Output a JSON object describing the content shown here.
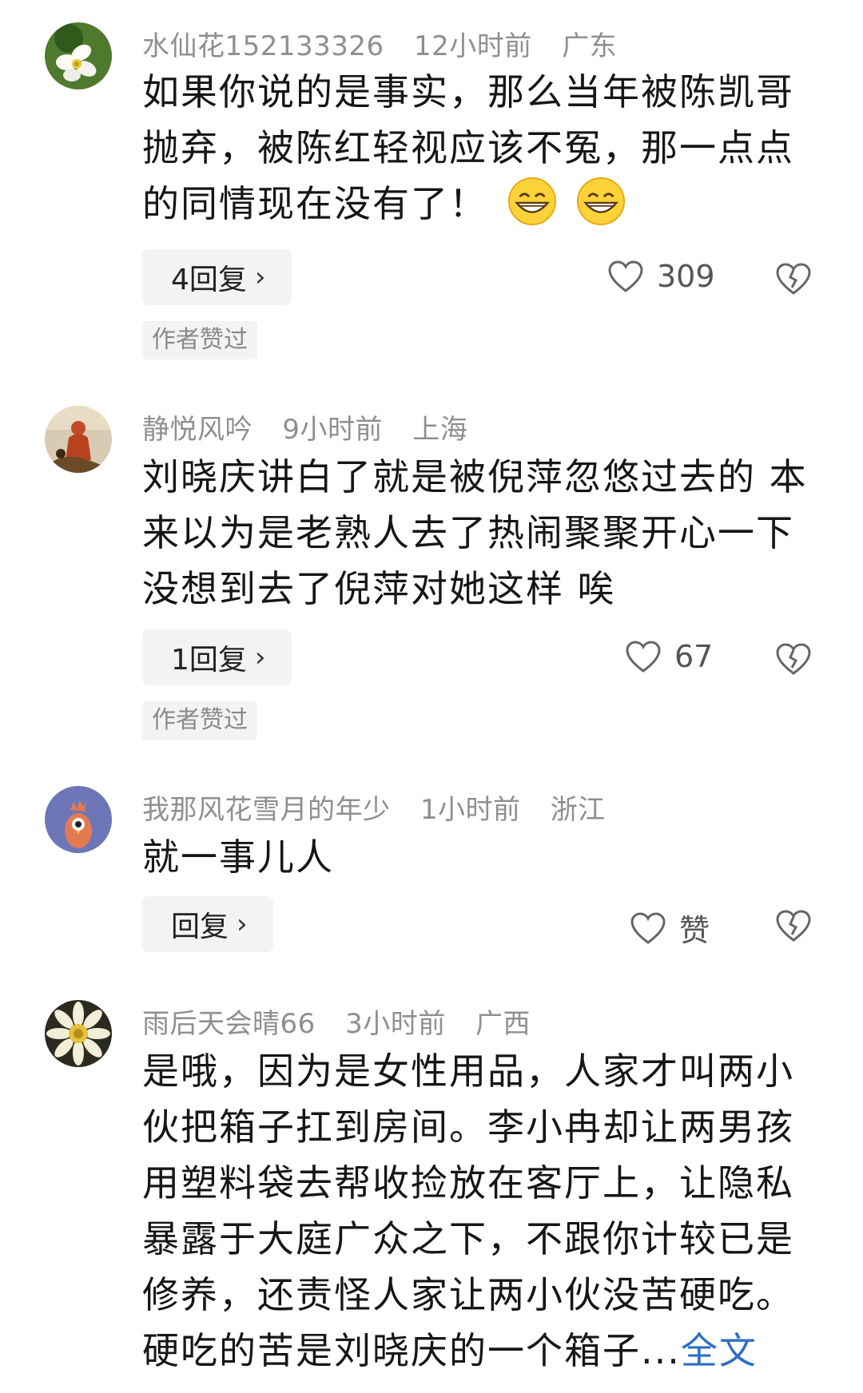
{
  "comments": [
    {
      "username": "水仙花152133326",
      "time": "12小时前",
      "location": "广东",
      "text": "如果你说的是事实，那么当年被陈凯哥抛弃，被陈红轻视应该不冤，那一点点的同情现在没有了！",
      "emoji": "grinning-face-emoji ×2",
      "reply_label": "4回复",
      "like_count": "309",
      "badge": "作者赞过"
    },
    {
      "username": "静悦风吟",
      "time": "9小时前",
      "location": "上海",
      "text": "刘晓庆讲白了就是被倪萍忽悠过去的 本来以为是老熟人去了热闹聚聚开心一下 没想到去了倪萍对她这样 唉",
      "reply_label": "1回复",
      "like_count": "67",
      "badge": "作者赞过"
    },
    {
      "username": "我那风花雪月的年少",
      "time": "1小时前",
      "location": "浙江",
      "text": "就一事儿人",
      "reply_label": "回复",
      "like_count": "赞"
    },
    {
      "username": "雨后天会晴66",
      "time": "3小时前",
      "location": "广西",
      "text": "是哦，因为是女性用品，人家才叫两小伙把箱子扛到房间。李小冉却让两男孩用塑料袋去帮收捡放在客厅上，让隐私暴露于大庭广众之下，不跟你计较已是修养，还责怪人家让两小伙没苦硬吃。硬吃的苦是刘晓庆的一个箱子...",
      "more_label": "全文"
    }
  ],
  "icons": {
    "reply_chevron": "chevron-right-icon",
    "like": "heart-outline-icon",
    "dislike": "broken-heart-icon"
  },
  "colors": {
    "meta": "#8f8f8f",
    "link": "#2d6fc4",
    "button_bg": "#f3f3f3"
  }
}
